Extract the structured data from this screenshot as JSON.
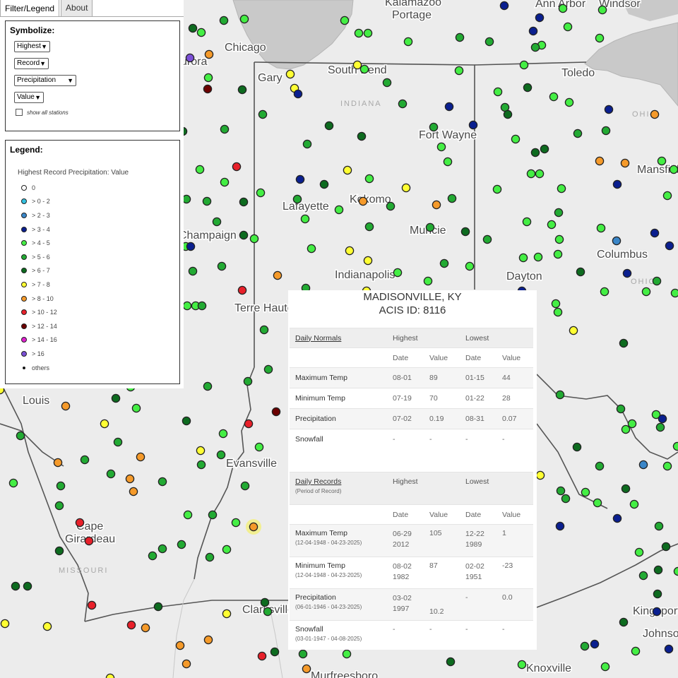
{
  "panel": {
    "tabs": [
      "Filter/Legend",
      "About"
    ],
    "symbolize_title": "Symbolize:",
    "selects": [
      "Highest",
      "Record",
      "Precipitation",
      "Value"
    ],
    "show_all_label": "show all stations",
    "legend_title": "Legend:",
    "legend_subtitle": "Highest Record Precipitation: Value",
    "legend_items": [
      {
        "label": "0",
        "color": "#ffffff"
      },
      {
        "label": "> 0 - 2",
        "color": "#33c1e0"
      },
      {
        "label": "> 2 - 3",
        "color": "#3a86c8"
      },
      {
        "label": "> 3 - 4",
        "color": "#0a1f8f"
      },
      {
        "label": "> 4 - 5",
        "color": "#44ee44"
      },
      {
        "label": "> 5 - 6",
        "color": "#22aa33"
      },
      {
        "label": "> 6 - 7",
        "color": "#0d6b1f"
      },
      {
        "label": "> 7 - 8",
        "color": "#ffff33"
      },
      {
        "label": "> 8 - 10",
        "color": "#f59a2a"
      },
      {
        "label": "> 10 - 12",
        "color": "#e8202a"
      },
      {
        "label": "> 12 - 14",
        "color": "#6b0000"
      },
      {
        "label": "> 14 - 16",
        "color": "#e020d0"
      },
      {
        "label": "> 16",
        "color": "#7b4fd6"
      },
      {
        "label": "others",
        "color": "#000000"
      }
    ]
  },
  "map": {
    "places": [
      "Chicago",
      "Gary",
      "South Bend",
      "Kalamazoo",
      "Portage",
      "Ann Arbor",
      "Windsor",
      "Toledo",
      "Fort Wayne",
      "Lafayette",
      "Kokomo",
      "Muncie",
      "Indianapolis",
      "Dayton",
      "Columbus",
      "Mansfield",
      "Champaign",
      "Terre Haute",
      "Louis",
      "Evansville",
      "Cape",
      "Girardeau",
      "Clarksville",
      "Kingsport",
      "Johnson",
      "Knoxville",
      "Murfreesboro",
      "urora"
    ],
    "states": [
      "INDIANA",
      "OHIO",
      "MISSOURI",
      "OHIO"
    ]
  },
  "popup": {
    "station": "MADISONVILLE, KY",
    "acis_id": "ACIS ID: 8116",
    "normals": {
      "title": "Daily Normals",
      "highest": "Highest",
      "lowest": "Lowest",
      "date": "Date",
      "value": "Value",
      "rows": [
        {
          "label": "Maximum Temp",
          "hdate": "08-01",
          "hval": "89",
          "ldate": "01-15",
          "lval": "44"
        },
        {
          "label": "Minimum Temp",
          "hdate": "07-19",
          "hval": "70",
          "ldate": "01-22",
          "lval": "28"
        },
        {
          "label": "Precipitation",
          "hdate": "07-02",
          "hval": "0.19",
          "ldate": "08-31",
          "lval": "0.07"
        },
        {
          "label": "Snowfall",
          "hdate": "-",
          "hval": "-",
          "ldate": "-",
          "lval": "-"
        }
      ]
    },
    "records": {
      "title": "Daily Records",
      "subtitle": "(Period of Record)",
      "highest": "Highest",
      "lowest": "Lowest",
      "date": "Date",
      "value": "Value",
      "rows": [
        {
          "label": "Maximum Temp",
          "period": "(12-04-1948 - 04-23-2025)",
          "hdate": "06-29 2012",
          "hval": "105",
          "ldate": "12-22 1989",
          "lval": "1"
        },
        {
          "label": "Minimum Temp",
          "period": "(12-04-1948 - 04-23-2025)",
          "hdate": "08-02 1982",
          "hval": "87",
          "ldate": "02-02 1951",
          "lval": "-23"
        },
        {
          "label": "Precipitation",
          "period": "(06-01-1946 - 04-23-2025)",
          "hdate": "03-02 1997",
          "hval": "10.2",
          "ldate": "-",
          "lval": "0.0"
        },
        {
          "label": "Snowfall",
          "period": "(03-01-1947 - 04-08-2025)",
          "hdate": "-",
          "hval": "-",
          "ldate": "-",
          "lval": "-"
        }
      ]
    }
  }
}
